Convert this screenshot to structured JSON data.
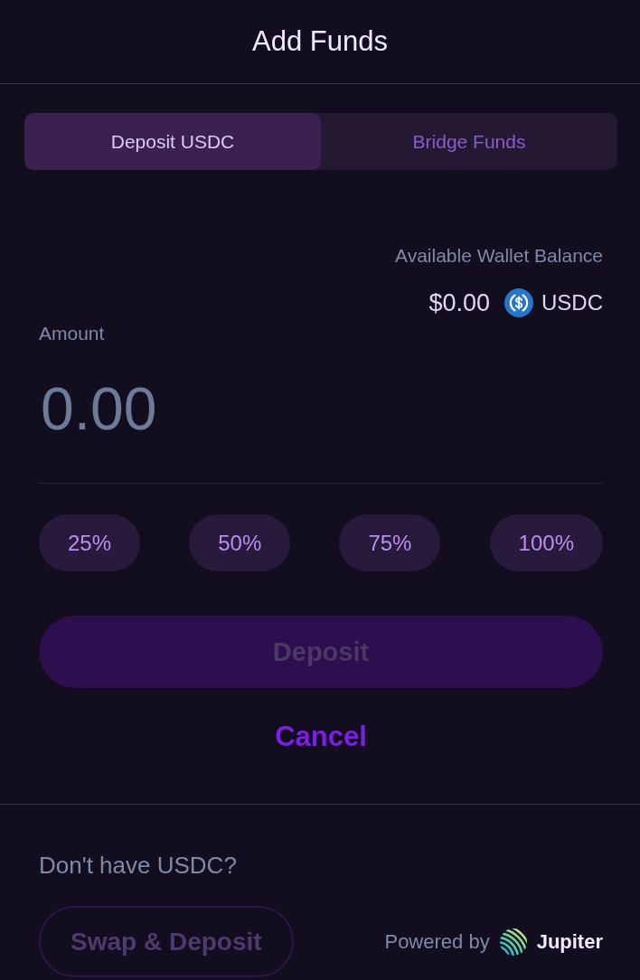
{
  "header": {
    "title": "Add Funds"
  },
  "tabs": [
    {
      "label": "Deposit USDC",
      "selected": true
    },
    {
      "label": "Bridge Funds",
      "selected": false
    }
  ],
  "balance": {
    "label": "Available Wallet Balance",
    "amount": "$0.00",
    "token": "USDC"
  },
  "amount": {
    "label": "Amount",
    "placeholder": "0.00"
  },
  "presets": [
    "25%",
    "50%",
    "75%",
    "100%"
  ],
  "deposit_button": {
    "label": "Deposit",
    "disabled": true
  },
  "cancel_link": {
    "label": "Cancel"
  },
  "footer": {
    "prompt": "Don't have USDC?",
    "swap_button": {
      "label": "Swap & Deposit",
      "disabled": true
    },
    "powered_by": "Powered by",
    "provider": "Jupiter"
  }
}
